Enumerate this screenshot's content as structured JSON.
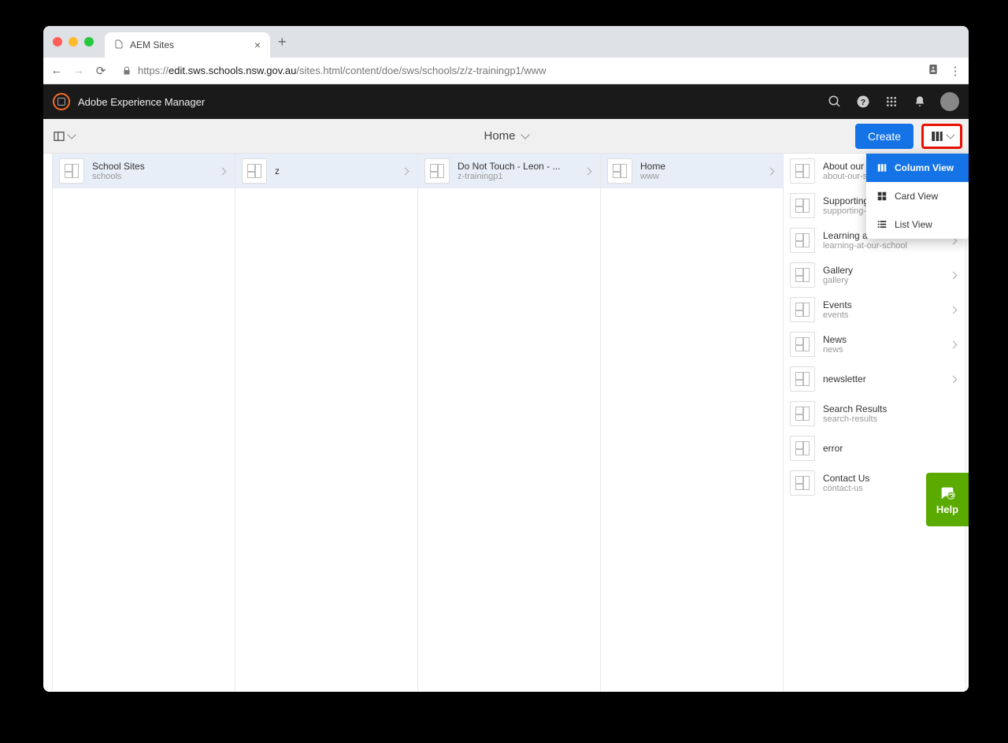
{
  "browser": {
    "tab_title": "AEM Sites",
    "url_prefix": "https://",
    "url_host": "edit.sws.schools.nsw.gov.au",
    "url_path": "/sites.html/content/doe/sws/schools/z/z-trainingp1/www"
  },
  "aem_header": {
    "product": "Adobe Experience Manager"
  },
  "actionbar": {
    "breadcrumb": "Home",
    "create": "Create"
  },
  "view_menu": {
    "column": "Column View",
    "card": "Card View",
    "list": "List View"
  },
  "columns": [
    {
      "selected": 0,
      "items": [
        {
          "title": "School Sites",
          "sub": "schools",
          "chev": true
        }
      ]
    },
    {
      "selected": 0,
      "items": [
        {
          "title": "z",
          "sub": "",
          "chev": true
        }
      ]
    },
    {
      "selected": 0,
      "items": [
        {
          "title": "Do Not Touch - Leon - ...",
          "sub": "z-trainingp1",
          "chev": true
        }
      ]
    },
    {
      "selected": 0,
      "items": [
        {
          "title": "Home",
          "sub": "www",
          "chev": true
        }
      ]
    },
    {
      "selected": -1,
      "items": [
        {
          "title": "About our school",
          "sub": "about-our-school",
          "chev": true
        },
        {
          "title": "Supporting our students",
          "sub": "supporting-our-students",
          "chev": true
        },
        {
          "title": "Learning at our school",
          "sub": "learning-at-our-school",
          "chev": true
        },
        {
          "title": "Gallery",
          "sub": "gallery",
          "chev": true
        },
        {
          "title": "Events",
          "sub": "events",
          "chev": true
        },
        {
          "title": "News",
          "sub": "news",
          "chev": true
        },
        {
          "title": "newsletter",
          "sub": "",
          "chev": true
        },
        {
          "title": "Search Results",
          "sub": "search-results",
          "chev": false
        },
        {
          "title": "error",
          "sub": "",
          "chev": false
        },
        {
          "title": "Contact Us",
          "sub": "contact-us",
          "chev": false
        }
      ]
    }
  ],
  "help_label": "Help"
}
